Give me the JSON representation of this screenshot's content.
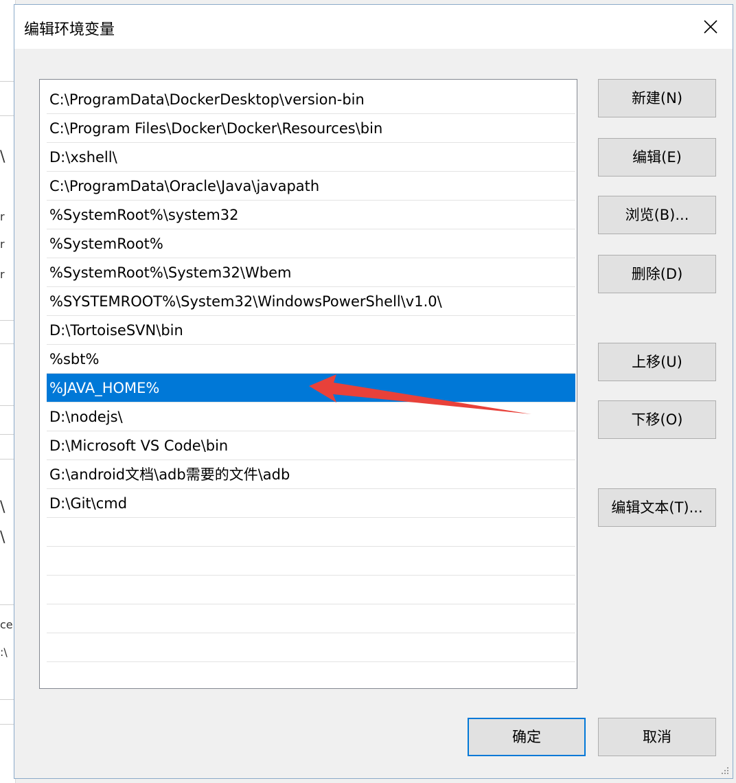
{
  "dialog": {
    "title": "编辑环境变量"
  },
  "background_fragments": [
    "\\",
    "r",
    "r",
    "r",
    "\\",
    "\\",
    "ce",
    ":\\"
  ],
  "path_entries": [
    "C:\\ProgramData\\DockerDesktop\\version-bin",
    "C:\\Program Files\\Docker\\Docker\\Resources\\bin",
    "D:\\xshell\\",
    "C:\\ProgramData\\Oracle\\Java\\javapath",
    "%SystemRoot%\\system32",
    "%SystemRoot%",
    "%SystemRoot%\\System32\\Wbem",
    "%SYSTEMROOT%\\System32\\WindowsPowerShell\\v1.0\\",
    "D:\\TortoiseSVN\\bin",
    "%sbt%",
    "%JAVA_HOME%",
    "D:\\nodejs\\",
    "D:\\Microsoft VS Code\\bin",
    "G:\\android文档\\adb需要的文件\\adb",
    "D:\\Git\\cmd"
  ],
  "selected_index": 10,
  "buttons": {
    "new": "新建(N)",
    "edit": "编辑(E)",
    "browse": "浏览(B)...",
    "delete": "删除(D)",
    "move_up": "上移(U)",
    "move_down": "下移(O)",
    "edit_text": "编辑文本(T)...",
    "ok": "确定",
    "cancel": "取消"
  },
  "colors": {
    "selection": "#0078d7",
    "annotation_arrow": "#e8413a",
    "default_button_border": "#0078d7"
  }
}
